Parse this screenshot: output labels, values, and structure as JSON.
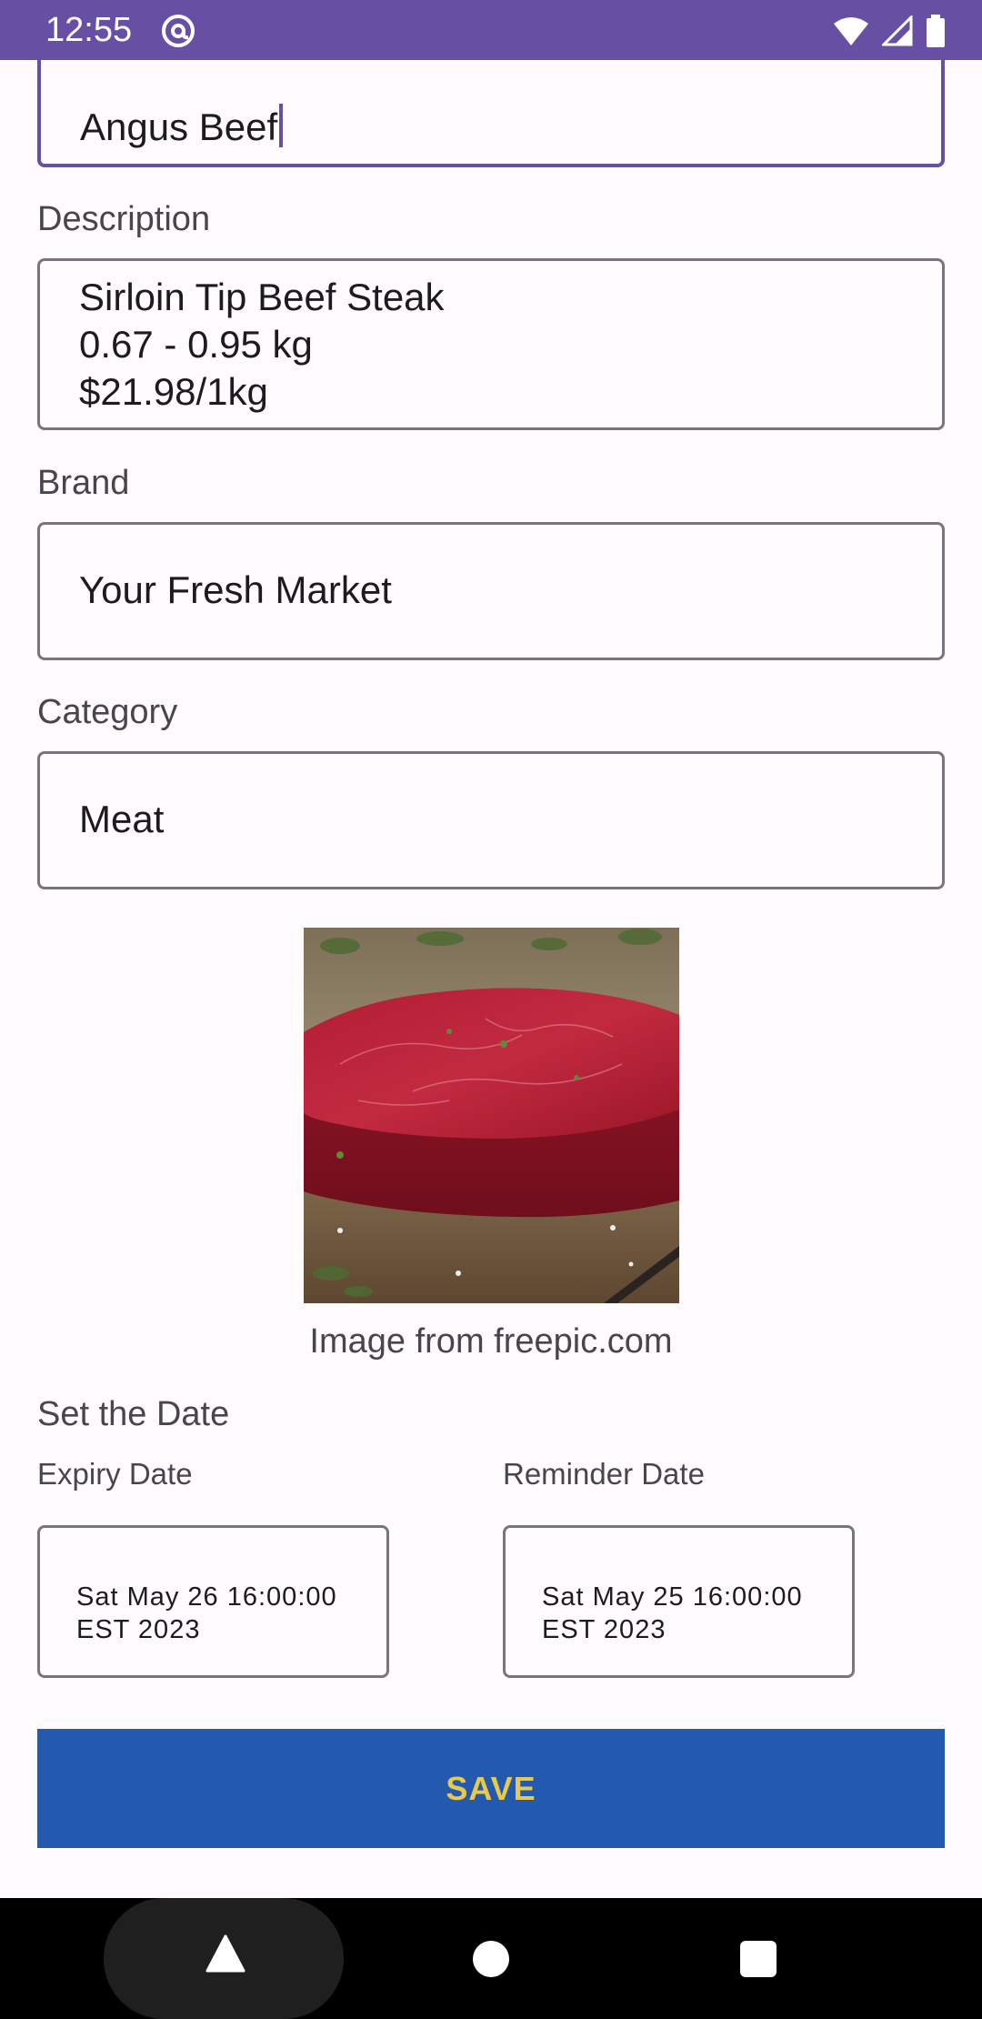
{
  "status_bar": {
    "time": "12:55",
    "app_icon": "at-sign-circle-icon",
    "icons": [
      "wifi-icon",
      "cellular-signal-icon",
      "battery-icon"
    ]
  },
  "form": {
    "name_field": {
      "value": "Angus Beef",
      "focused": true
    },
    "description": {
      "label": "Description",
      "value": "Sirloin Tip Beef Steak\n0.67 - 0.95 kg\n$21.98/1kg"
    },
    "brand": {
      "label": "Brand",
      "value": "Your Fresh Market"
    },
    "category": {
      "label": "Category",
      "value": "Meat"
    }
  },
  "image": {
    "caption": "Image from freepic.com"
  },
  "dates": {
    "section_title": "Set the Date",
    "expiry": {
      "label": "Expiry Date",
      "value": "Sat May 26 16:00:00\nEST 2023"
    },
    "reminder": {
      "label": "Reminder Date",
      "value": "Sat May 25 16:00:00\nEST 2023"
    }
  },
  "save_button": {
    "label": "SAVE"
  },
  "nav_bar": {
    "icons": [
      "back-triangle-icon",
      "home-circle-icon",
      "recents-square-icon"
    ]
  },
  "colors": {
    "status_bar": "#6750a4",
    "focus_border": "#6750a4",
    "save_button_bg": "#2459b0",
    "save_button_text": "#e8c94a",
    "background": "#fffbfe"
  }
}
